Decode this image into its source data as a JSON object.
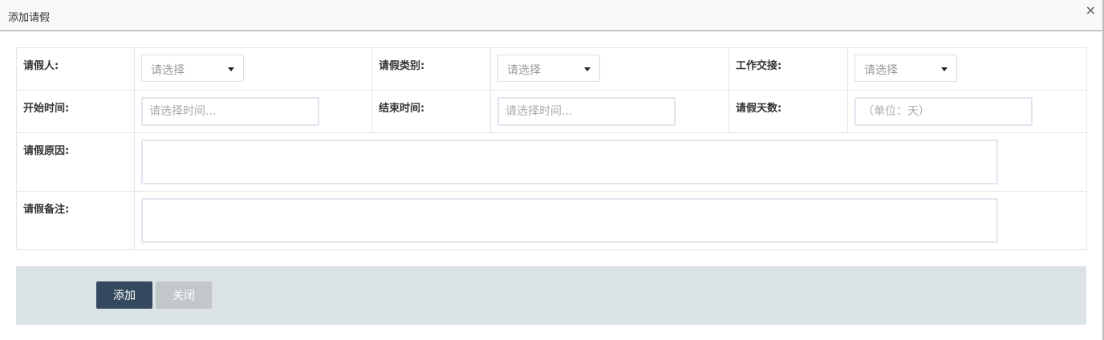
{
  "dialog": {
    "title": "添加请假",
    "close_glyph": "×"
  },
  "form": {
    "row1": [
      {
        "label": "请假人:",
        "placeholder": "请选择"
      },
      {
        "label": "请假类别:",
        "placeholder": "请选择"
      },
      {
        "label": "工作交接:",
        "placeholder": "请选择"
      }
    ],
    "row2": [
      {
        "label": "开始时间:",
        "placeholder": "请选择时间..."
      },
      {
        "label": "结束时间:",
        "placeholder": "请选择时间..."
      },
      {
        "label": "请假天数:",
        "placeholder": "（单位：天）"
      }
    ],
    "reason_label": "请假原因:",
    "remark_label": "请假备注:"
  },
  "footer": {
    "add_label": "添加",
    "close_label": "关闭"
  }
}
